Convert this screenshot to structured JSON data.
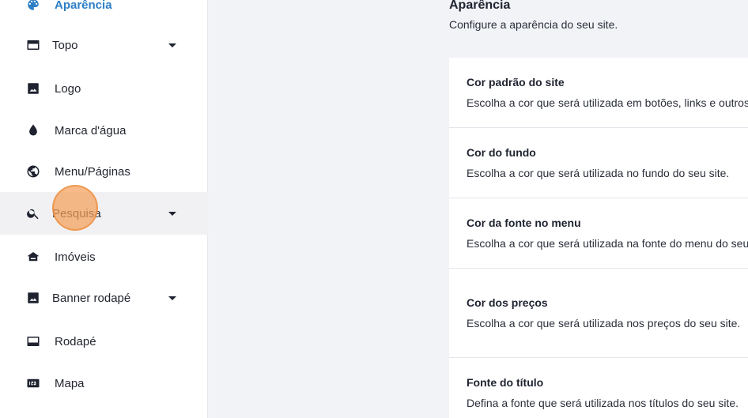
{
  "sidebar": {
    "items": [
      {
        "label": "Aparência",
        "icon": "palette-icon"
      },
      {
        "label": "Topo",
        "icon": "top-bar-icon",
        "expandable": true
      },
      {
        "label": "Logo",
        "icon": "image-icon"
      },
      {
        "label": "Marca d'água",
        "icon": "water-drop-icon"
      },
      {
        "label": "Menu/Páginas",
        "icon": "globe-icon"
      },
      {
        "label": "Pesquisa",
        "icon": "search-icon",
        "expandable": true
      },
      {
        "label": "Imóveis",
        "icon": "house-icon"
      },
      {
        "label": "Banner rodapé",
        "icon": "image-icon",
        "expandable": true
      },
      {
        "label": "Rodapé",
        "icon": "footer-icon"
      },
      {
        "label": "Mapa",
        "icon": "numbers-icon"
      }
    ]
  },
  "main": {
    "title": "Aparência",
    "subtitle": "Configure a aparência do seu site.",
    "cards": [
      {
        "title": "Cor padrão do site",
        "description": "Escolha a cor que será utilizada em botões, links e outros"
      },
      {
        "title": "Cor do fundo",
        "description": "Escolha a cor que será utilizada no fundo do seu site."
      },
      {
        "title": "Cor da fonte no menu",
        "description": "Escolha a cor que será utilizada na fonte do menu do seu site."
      },
      {
        "title": "Cor dos preços",
        "description": "Escolha a cor que será utilizada nos preços do seu site."
      },
      {
        "title": "Fonte do título",
        "description": "Defina a fonte que será utilizada nos títulos do seu site."
      }
    ]
  },
  "colors": {
    "accent": "#2d7ec6",
    "hover": "#f1f1f3",
    "click_indicator": "#f4a05a"
  }
}
